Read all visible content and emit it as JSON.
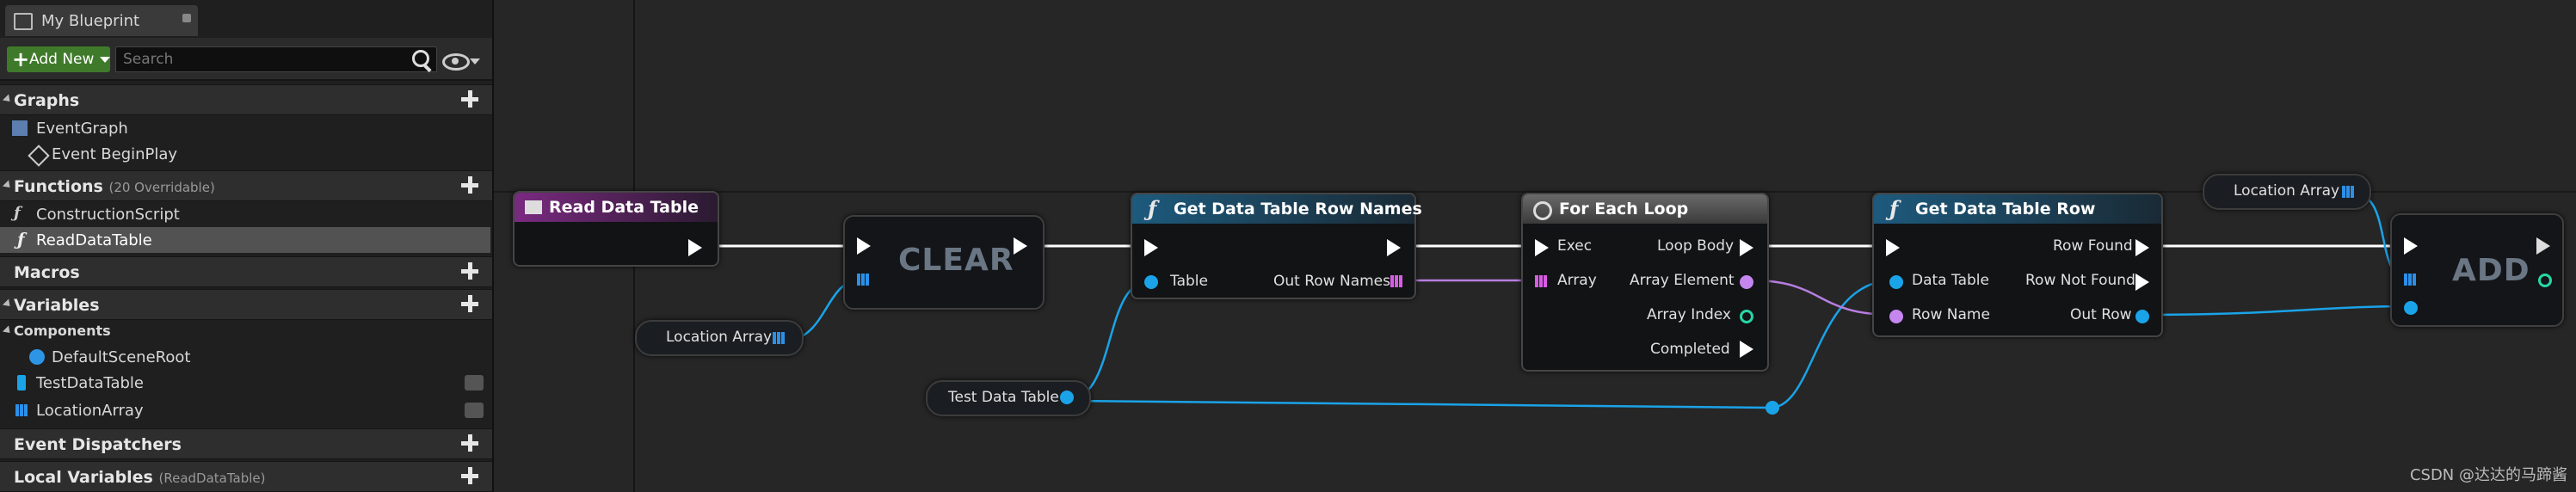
{
  "panel": {
    "tab_title": "My Blueprint",
    "add_new_label": "Add New",
    "search_placeholder": "Search",
    "sections": {
      "graphs": "Graphs",
      "functions": "Functions",
      "functions_sub": "(20 Overridable)",
      "macros": "Macros",
      "variables": "Variables",
      "event_dispatchers": "Event Dispatchers",
      "local_variables": "Local Variables",
      "local_variables_sub": "(ReadDataTable)"
    },
    "items": {
      "event_graph": "EventGraph",
      "event_begin_play": "Event BeginPlay",
      "construction_script": "ConstructionScript",
      "read_data_table": "ReadDataTable",
      "components": "Components",
      "default_scene_root": "DefaultSceneRoot",
      "test_data_table": "TestDataTable",
      "location_array": "LocationArray"
    }
  },
  "nodes": {
    "read_data_table": {
      "title": "Read Data Table"
    },
    "clear": {
      "label": "CLEAR"
    },
    "get_row_names": {
      "title": "Get Data Table Row Names",
      "in_table": "Table",
      "out_row_names": "Out Row Names"
    },
    "for_each": {
      "title": "For Each Loop",
      "exec": "Exec",
      "array": "Array",
      "loop_body": "Loop Body",
      "array_element": "Array Element",
      "array_index": "Array Index",
      "completed": "Completed"
    },
    "get_row": {
      "title": "Get Data Table Row",
      "data_table": "Data Table",
      "row_name": "Row Name",
      "row_found": "Row Found",
      "row_not_found": "Row Not Found",
      "out_row": "Out Row"
    },
    "add": {
      "label": "ADD"
    },
    "var_location_array_1": "Location Array",
    "var_location_array_2": "Location Array",
    "var_test_data_table": "Test Data Table"
  },
  "colors": {
    "exec": "#ffffff",
    "object": "#1aa3e8",
    "name": "#c586f0",
    "integer": "#27d7a6",
    "function_header": "#1d5a7d",
    "event_header": "#6b1f6e",
    "loop_header": "#555555"
  },
  "watermark": "CSDN @达达的马蹄酱"
}
